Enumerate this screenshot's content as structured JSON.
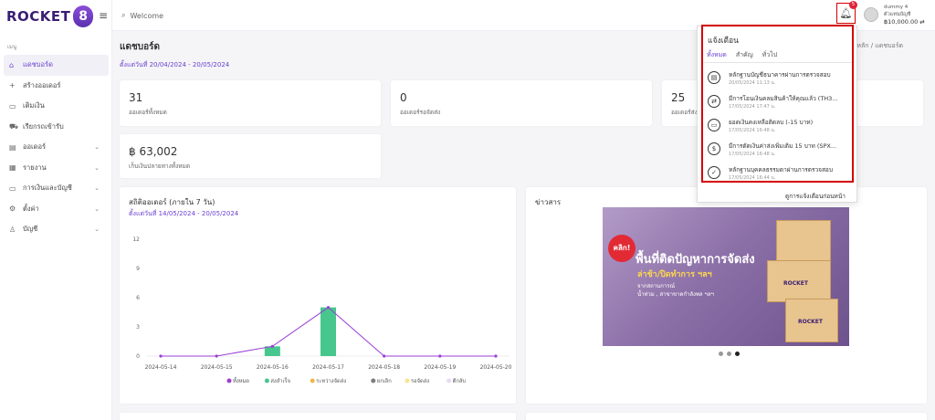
{
  "app": {
    "brand_text": "ROCKET",
    "brand_digit": "8"
  },
  "sidebar": {
    "menu_title": "เมนู",
    "items": [
      {
        "label": "แดชบอร์ด",
        "icon": "home-icon"
      },
      {
        "label": "สร้างออเดอร์",
        "icon": "plus-icon"
      },
      {
        "label": "เติมเงิน",
        "icon": "wallet-icon"
      },
      {
        "label": "เรียกรถเข้ารับ",
        "icon": "truck-icon"
      },
      {
        "label": "ออเดอร์",
        "icon": "box-icon"
      },
      {
        "label": "รายงาน",
        "icon": "report-icon"
      },
      {
        "label": "การเงินและบัญชี",
        "icon": "money-icon"
      },
      {
        "label": "ตั้งค่า",
        "icon": "gear-icon"
      },
      {
        "label": "บัญชี",
        "icon": "user-icon"
      }
    ]
  },
  "topbar": {
    "search_text": "Welcome",
    "notification_count": "5",
    "user_name": "dummy 4",
    "user_role": "ตัวแทนบัญชี",
    "balance": "฿10,000.00"
  },
  "page": {
    "title": "แดชบอร์ด",
    "breadcrumb": "หน้าหลัก / แดชบอร์ด",
    "date_range": "ตั้งแต่วันที่ 20/04/2024 - 20/05/2024"
  },
  "stats": [
    {
      "value": "31",
      "label": "ออเดอร์ทั้งหมด"
    },
    {
      "value": "0",
      "label": "ออเดอร์รอจัดส่ง"
    },
    {
      "value": "25",
      "label": "ออเดอร์ส่ง"
    },
    {
      "value": "฿ 63,002",
      "label": "เก็บเงินปลายทางทั้งหมด"
    }
  ],
  "chart_card": {
    "title": "สถิติออเดอร์ (ภายใน 7 วัน)",
    "subtitle": "ตั้งแต่วันที่ 14/05/2024 - 20/05/2024"
  },
  "chart_data": {
    "type": "bar",
    "categories": [
      "2024-05-14",
      "2024-05-15",
      "2024-05-16",
      "2024-05-17",
      "2024-05-18",
      "2024-05-19",
      "2024-05-20"
    ],
    "ylim": [
      0,
      12
    ],
    "yticks": [
      0,
      3,
      6,
      9,
      12
    ],
    "series": [
      {
        "name": "ทั้งหมด",
        "type": "line",
        "color": "#9b3fd6",
        "values": [
          0,
          0,
          1,
          5,
          0,
          0,
          0
        ]
      },
      {
        "name": "ส่งสำเร็จ",
        "type": "bar",
        "color": "#47c78e",
        "values": [
          0,
          0,
          1,
          5,
          0,
          0,
          0
        ]
      },
      {
        "name": "ระหว่างจัดส่ง",
        "type": "bar",
        "color": "#f0b84a",
        "values": [
          0,
          0,
          0,
          0,
          0,
          0,
          0
        ]
      },
      {
        "name": "ยกเลิก",
        "type": "bar",
        "color": "#7d7d7d",
        "values": [
          0,
          0,
          0,
          0,
          0,
          0,
          0
        ]
      },
      {
        "name": "รอจัดส่ง",
        "type": "bar",
        "color": "#f7e58a",
        "values": [
          0,
          0,
          0,
          0,
          0,
          0,
          0
        ]
      },
      {
        "name": "ตีกลับ",
        "type": "bar",
        "color": "#ead9f5",
        "values": [
          0,
          0,
          0,
          0,
          0,
          0,
          0
        ]
      }
    ],
    "legend_position": "bottom"
  },
  "news": {
    "title": "ข่าวสาร",
    "banner_click": "คลิก!",
    "banner_h1": "พื้นที่ติดปัญหาการจัดส่ง",
    "banner_h2": "ล่าช้า/ปิดทำการ ฯลฯ",
    "banner_h3a": "จากสถานการณ์",
    "banner_h3b": "น้ำท่วม , สาขาขาดกำลังพล ฯลฯ",
    "banner_logo": "ROCKET"
  },
  "notifications": {
    "title": "แจ้งเตือน",
    "tabs": [
      "ทั้งหมด",
      "สำคัญ",
      "ทั่วไป"
    ],
    "items": [
      {
        "icon": "document-icon",
        "title": "หลักฐานบัญชีธนาคารผ่านการตรวจสอบ",
        "date": "20/05/2024 11:13 น."
      },
      {
        "icon": "money-transfer-icon",
        "title": "มีการโอนเงินคลมสินค้าให้คุณแล้ว (TH3...",
        "date": "17/05/2024 17:47 น."
      },
      {
        "icon": "wallet-low-icon",
        "title": "ยอดเงินคงเหลือติดลบ (-15 บาท)",
        "date": "17/05/2024 16:48 น."
      },
      {
        "icon": "coin-icon",
        "title": "มีการตัดเงินค่าส่งเพิ่มเติม 15 บาท (SPX...",
        "date": "17/05/2024 16:48 น."
      },
      {
        "icon": "document-check-icon",
        "title": "หลักฐานบุคคลธรรมดาผ่านการตรวจสอบ",
        "date": "17/05/2024 16:44 น."
      }
    ],
    "footer_link": "ดูการแจ้งเตือนก่อนหน้า"
  }
}
